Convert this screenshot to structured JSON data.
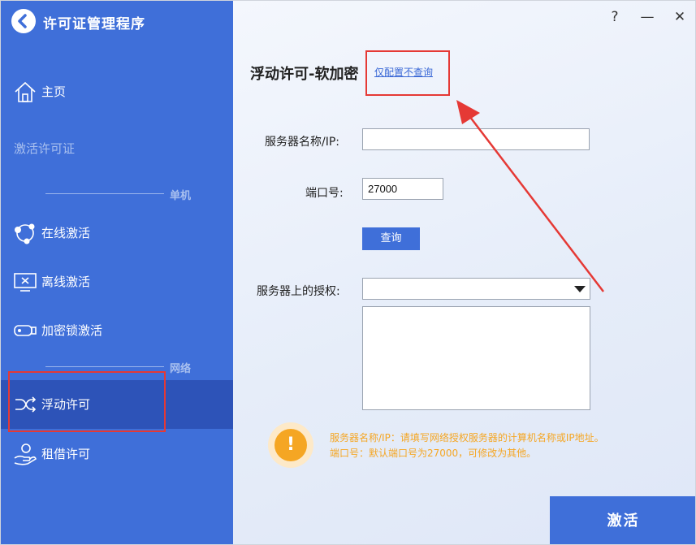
{
  "app": {
    "title": "许可证管理程序"
  },
  "window_controls": {
    "help": "?",
    "minimize": "—",
    "close": "✕"
  },
  "sidebar": {
    "home": "主页",
    "activate_license": "激活许可证",
    "section_standalone": "单机",
    "online_activation": "在线激活",
    "offline_activation": "离线激活",
    "dongle_activation": "加密锁激活",
    "section_network": "网络",
    "floating_license": "浮动许可",
    "borrow_license": "租借许可"
  },
  "main": {
    "page_title": "浮动许可-软加密",
    "config_only_link": "仅配置不查询",
    "server_name_label": "服务器名称/IP:",
    "server_name_value": "",
    "port_label": "端口号:",
    "port_value": "27000",
    "query_button": "查询",
    "server_license_label": "服务器上的授权:",
    "server_license_selected": "",
    "hint_icon": "!",
    "hint_line1": "服务器名称/IP：请填写网络授权服务器的计算机名称或IP地址。",
    "hint_line2": "端口号：默认端口号为27000，可修改为其他。",
    "activate_button": "激活"
  },
  "colors": {
    "sidebar_bg": "#3f6fd9",
    "sidebar_active": "#2d53b8",
    "accent": "#3f6fd9",
    "hint": "#f5a623",
    "annotation": "#e53935"
  },
  "icons": {
    "back": "back-arrow-icon",
    "home": "home-icon",
    "online": "network-nodes-icon",
    "offline": "monitor-icon",
    "dongle": "usb-dongle-icon",
    "floating": "shuffle-icon",
    "borrow": "hand-lend-icon",
    "hint": "warning-icon"
  }
}
